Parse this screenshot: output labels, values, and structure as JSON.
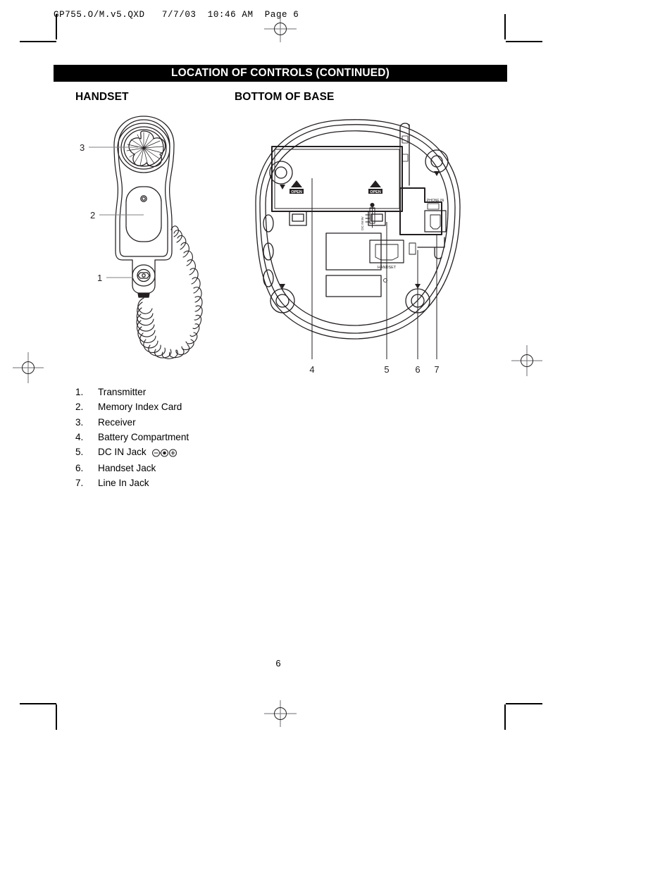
{
  "print_header": {
    "text": "GP755.O/M.v5.QXD   7/7/03  10:46 AM  Page 6"
  },
  "title_bar": {
    "text": "LOCATION OF CONTROLS (CONTINUED)"
  },
  "sections": {
    "handset_heading": "HANDSET",
    "base_heading": "BOTTOM OF BASE"
  },
  "handset_figure": {
    "callouts": [
      {
        "number": "3",
        "target": "receiver"
      },
      {
        "number": "2",
        "target": "memory-index-card"
      },
      {
        "number": "1",
        "target": "transmitter"
      }
    ]
  },
  "base_figure": {
    "callouts": [
      {
        "number": "4",
        "target": "battery-compartment"
      },
      {
        "number": "5",
        "target": "dc-in-jack"
      },
      {
        "number": "6",
        "target": "handset-jack"
      },
      {
        "number": "7",
        "target": "line-in-jack"
      }
    ],
    "inline_labels": {
      "open_left": "OPEN",
      "open_right": "OPEN",
      "handset_jack": "HANDSET",
      "line_in_jack": "PHONE IN",
      "dc_in_jack": "DC IN 9V"
    }
  },
  "legend": {
    "items": [
      {
        "num": "1.",
        "label": "Transmitter",
        "symbol": null
      },
      {
        "num": "2.",
        "label": "Memory Index Card",
        "symbol": null
      },
      {
        "num": "3.",
        "label": "Receiver",
        "symbol": null
      },
      {
        "num": "4.",
        "label": "Battery Compartment",
        "symbol": null
      },
      {
        "num": "5.",
        "label": "DC IN Jack",
        "symbol": "dc-polarity-symbol"
      },
      {
        "num": "6.",
        "label": "Handset Jack",
        "symbol": null
      },
      {
        "num": "7.",
        "label": "Line In Jack",
        "symbol": null
      }
    ]
  },
  "footer": {
    "page_number": "6"
  },
  "colors": {
    "ink": "#000000",
    "paper": "#ffffff",
    "line": "#231f20",
    "mark": "#6d6e71"
  }
}
